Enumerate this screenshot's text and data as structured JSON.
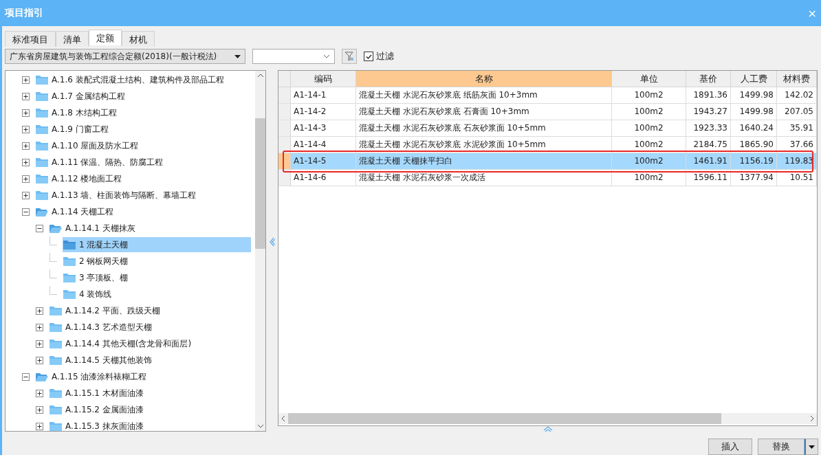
{
  "window": {
    "title": "项目指引",
    "close": "×"
  },
  "tabs": [
    {
      "label": "标准项目",
      "selected": false
    },
    {
      "label": "清单",
      "selected": false
    },
    {
      "label": "定额",
      "selected": true
    },
    {
      "label": "材机",
      "selected": false
    }
  ],
  "toolbar": {
    "library": "广东省房屋建筑与装饰工程综合定额(2018)(一般计税法)",
    "filter_checkbox": {
      "label": "过滤",
      "checked": true
    }
  },
  "tree": [
    {
      "label": "A.1.6 装配式混凝土结构、建筑构件及部品工程",
      "expanded": false,
      "selected": false
    },
    {
      "label": "A.1.7 金属结构工程",
      "expanded": false,
      "selected": false
    },
    {
      "label": "A.1.8 木结构工程",
      "expanded": false,
      "selected": false
    },
    {
      "label": "A.1.9 门窗工程",
      "expanded": false,
      "selected": false
    },
    {
      "label": "A.1.10 屋面及防水工程",
      "expanded": false,
      "selected": false
    },
    {
      "label": "A.1.11 保温、隔热、防腐工程",
      "expanded": false,
      "selected": false
    },
    {
      "label": "A.1.12 楼地面工程",
      "expanded": false,
      "selected": false
    },
    {
      "label": "A.1.13 墙、柱面装饰与隔断、幕墙工程",
      "expanded": false,
      "selected": false
    },
    {
      "label": "A.1.14 天棚工程",
      "expanded": true,
      "selected": false,
      "children": [
        {
          "label": "A.1.14.1 天棚抹灰",
          "expanded": true,
          "selected": false,
          "children": [
            {
              "label": "1 混凝土天棚",
              "selected": true
            },
            {
              "label": "2 钢板网天棚",
              "selected": false
            },
            {
              "label": "3 亭顶板、棚",
              "selected": false
            },
            {
              "label": "4 装饰线",
              "selected": false
            }
          ]
        },
        {
          "label": "A.1.14.2 平面、跌级天棚",
          "expanded": false,
          "selected": false
        },
        {
          "label": "A.1.14.3 艺术造型天棚",
          "expanded": false,
          "selected": false
        },
        {
          "label": "A.1.14.4 其他天棚(含龙骨和面层)",
          "expanded": false,
          "selected": false
        },
        {
          "label": "A.1.14.5 天棚其他装饰",
          "expanded": false,
          "selected": false
        }
      ]
    },
    {
      "label": "A.1.15 油漆涂料裱糊工程",
      "expanded": true,
      "selected": false,
      "children": [
        {
          "label": "A.1.15.1 木材面油漆",
          "expanded": false,
          "selected": false
        },
        {
          "label": "A.1.15.2 金属面油漆",
          "expanded": false,
          "selected": false
        },
        {
          "label": "A.1.15.3 抹灰面油漆",
          "expanded": false,
          "selected": false
        }
      ]
    }
  ],
  "table": {
    "columns": [
      {
        "label": "编码",
        "highlighted": false
      },
      {
        "label": "名称",
        "highlighted": true
      },
      {
        "label": "单位",
        "highlighted": false
      },
      {
        "label": "基价",
        "highlighted": false
      },
      {
        "label": "人工费",
        "highlighted": false
      },
      {
        "label": "材料费",
        "highlighted": false
      }
    ],
    "rows": [
      {
        "cells": [
          "A1-14-1",
          "混凝土天棚 水泥石灰砂浆底 纸筋灰面 10+3mm",
          "100m2",
          "1891.36",
          "1499.98",
          "142.02"
        ],
        "selected": false,
        "highlighted": false
      },
      {
        "cells": [
          "A1-14-2",
          "混凝土天棚 水泥石灰砂浆底 石膏面 10+3mm",
          "100m2",
          "1943.27",
          "1499.98",
          "207.05"
        ],
        "selected": false,
        "highlighted": false
      },
      {
        "cells": [
          "A1-14-3",
          "混凝土天棚 水泥石灰砂浆底 石灰砂浆面 10+5mm",
          "100m2",
          "1923.33",
          "1640.24",
          "35.91"
        ],
        "selected": false,
        "highlighted": false
      },
      {
        "cells": [
          "A1-14-4",
          "混凝土天棚 水泥石灰砂浆底 水泥砂浆面 10+5mm",
          "100m2",
          "2184.75",
          "1865.90",
          "37.66"
        ],
        "selected": false,
        "highlighted": false
      },
      {
        "cells": [
          "A1-14-5",
          "混凝土天棚 天棚抹平扫白",
          "100m2",
          "1461.91",
          "1156.19",
          "119.83"
        ],
        "selected": true,
        "highlighted": true
      },
      {
        "cells": [
          "A1-14-6",
          "混凝土天棚 水泥石灰砂浆一次成活",
          "100m2",
          "1596.11",
          "1377.94",
          "10.51"
        ],
        "selected": false,
        "highlighted": false
      }
    ]
  },
  "buttons": [
    {
      "label": "插入",
      "kind": "plain"
    },
    {
      "label": "替换",
      "kind": "split"
    }
  ]
}
